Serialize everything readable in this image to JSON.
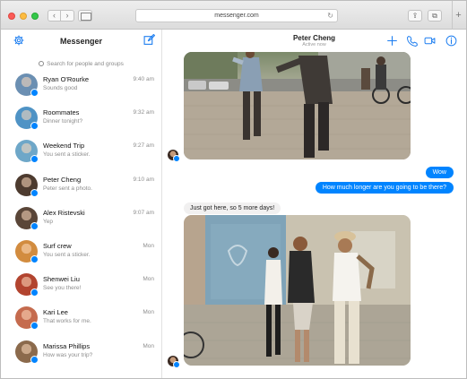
{
  "browser": {
    "url": "messenger.com",
    "back_glyph": "‹",
    "forward_glyph": "›",
    "reload_glyph": "↻",
    "share_glyph": "⇪",
    "tabs_glyph": "⧉",
    "newtab_glyph": "+"
  },
  "sidebar": {
    "title": "Messenger",
    "search_placeholder": "Search for people and groups",
    "conversations": [
      {
        "name": "Ryan O'Rourke",
        "preview": "Sounds good",
        "time": "9:40 am",
        "avatar_color": "#6b8fb2"
      },
      {
        "name": "Roommates",
        "preview": "Dinner tonight?",
        "time": "9:32 am",
        "avatar_color": "#4f93c5"
      },
      {
        "name": "Weekend Trip",
        "preview": "You sent a sticker.",
        "time": "9:27 am",
        "avatar_color": "#6ea7c8"
      },
      {
        "name": "Peter Cheng",
        "preview": "Peter sent a photo.",
        "time": "9:10 am",
        "avatar_color": "#4d3b2f"
      },
      {
        "name": "Alex Ristevski",
        "preview": "Yep",
        "time": "9:07 am",
        "avatar_color": "#5a4638"
      },
      {
        "name": "Surf crew",
        "preview": "You sent a sticker.",
        "time": "Mon",
        "avatar_color": "#d28c3f"
      },
      {
        "name": "Shenwei Liu",
        "preview": "See you there!",
        "time": "Mon",
        "avatar_color": "#b2442f"
      },
      {
        "name": "Kari Lee",
        "preview": "That works for me.",
        "time": "Mon",
        "avatar_color": "#c56b4e"
      },
      {
        "name": "Marissa Phillips",
        "preview": "How was your trip?",
        "time": "Mon",
        "avatar_color": "#8b6a4c"
      }
    ]
  },
  "conversation": {
    "name": "Peter Cheng",
    "status": "Active now",
    "messages": {
      "outgoing_1": "Wow",
      "outgoing_2": "How much longer are you going to be there?",
      "incoming_1": "Just got here, so 5 more days!"
    }
  },
  "colors": {
    "accent": "#0084ff"
  }
}
